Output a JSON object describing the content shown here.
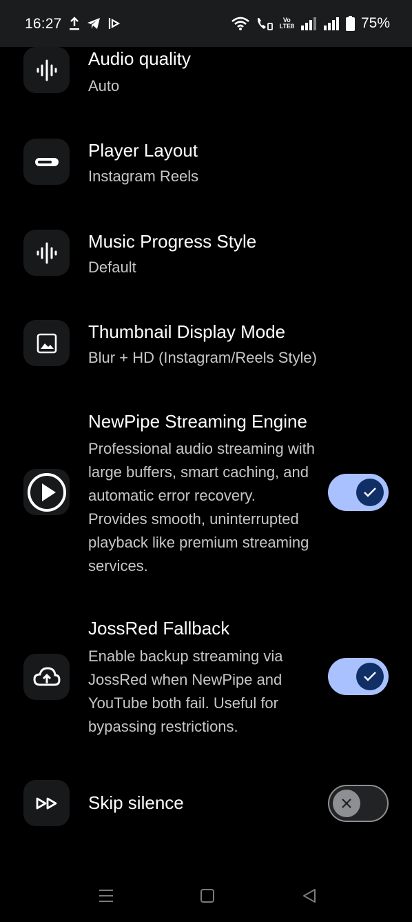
{
  "status_bar": {
    "time": "16:27",
    "battery_text": "75%",
    "volte_top": "Vo",
    "volte_bottom": "LTE8"
  },
  "settings": {
    "audio_quality": {
      "title": "Audio quality",
      "subtitle": "Auto",
      "icon": "waveform-icon"
    },
    "player_layout": {
      "title": "Player Layout",
      "subtitle": "Instagram Reels",
      "icon": "pill-icon"
    },
    "music_progress": {
      "title": "Music Progress Style",
      "subtitle": "Default",
      "icon": "waveform-icon"
    },
    "thumbnail_mode": {
      "title": "Thumbnail Display Mode",
      "subtitle": "Blur + HD (Instagram/Reels Style)",
      "icon": "image-icon"
    },
    "newpipe": {
      "title": "NewPipe Streaming Engine",
      "description": "Professional audio streaming with large buffers, smart caching, and automatic error recovery. Provides smooth, uninterrupted playback like premium streaming services.",
      "enabled": true,
      "icon": "play-circle-icon"
    },
    "jossred": {
      "title": "JossRed Fallback",
      "description": "Enable backup streaming via JossRed when NewPipe and YouTube both fail. Useful for bypassing restrictions.",
      "enabled": true,
      "icon": "cloud-upload-icon"
    },
    "skip_silence": {
      "title": "Skip silence",
      "enabled": false,
      "icon": "fast-forward-icon"
    }
  },
  "colors": {
    "background": "#000000",
    "toggle_on_track": "#a9c1ff",
    "toggle_on_knob": "#0f2f66",
    "toggle_off_track": "#222325",
    "toggle_off_knob": "#8e8f92"
  }
}
